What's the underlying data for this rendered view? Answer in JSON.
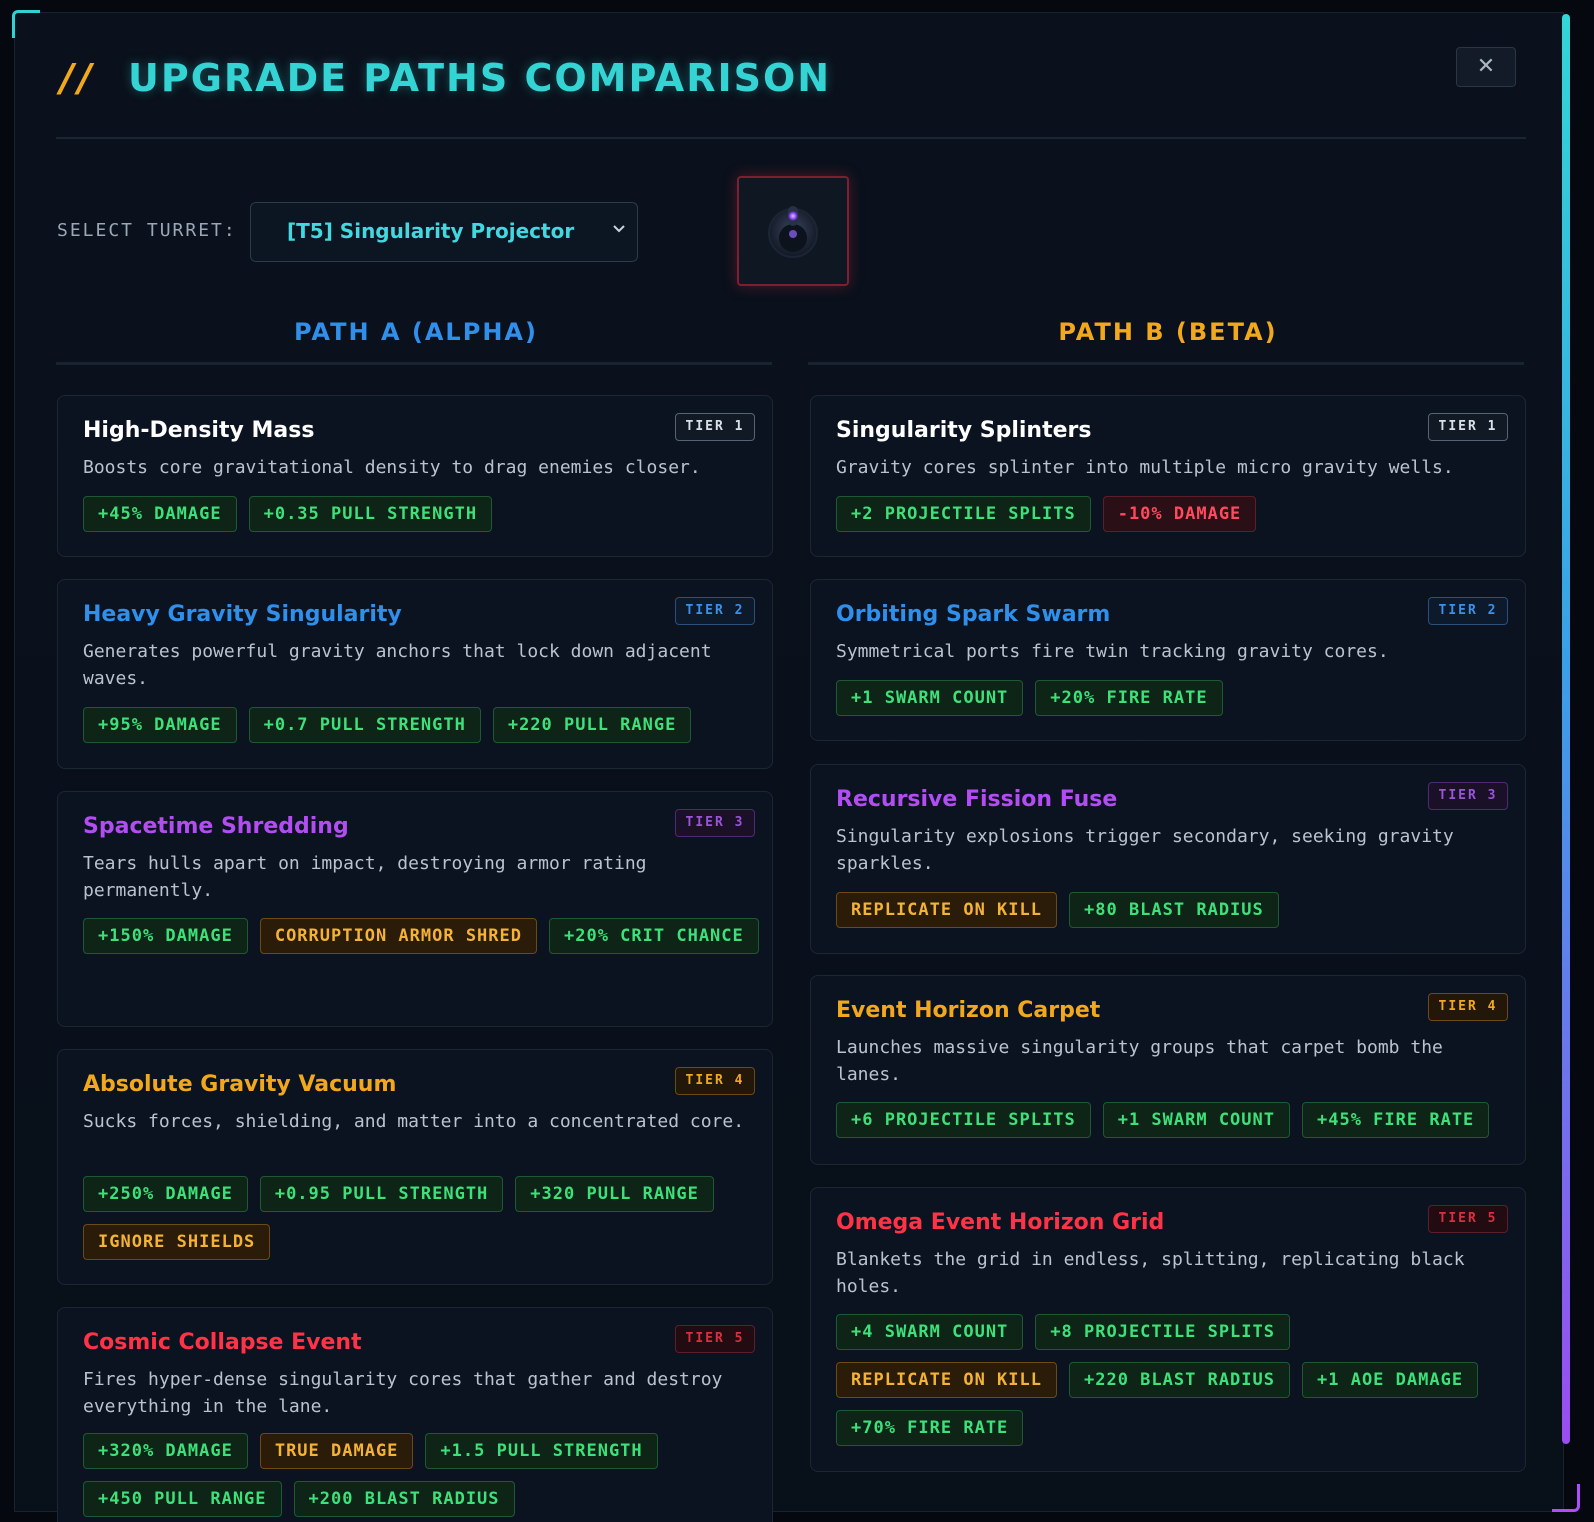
{
  "header": {
    "slash": "//",
    "title": "UPGRADE PATHS COMPARISON",
    "close_icon": "close-icon",
    "close_glyph": "✕"
  },
  "turret": {
    "label": "SELECT TURRET:",
    "selected": "[T5] Singularity Projector",
    "preview_icon": "singularity-turret-icon"
  },
  "colors": {
    "path_a": "#2f8fea",
    "path_b": "#f2a81d",
    "accent": "#35d4d4",
    "positive": "#3ee07a",
    "negative": "#ff4a5e",
    "special": "#f4b236"
  },
  "path_a": {
    "title": "PATH A (ALPHA)",
    "tiers": [
      {
        "name": "High-Density Mass",
        "tier": "TIER 1",
        "desc": "Boosts core gravitational density to drag enemies closer.",
        "tags": [
          {
            "text": "+45% DAMAGE",
            "kind": "pos"
          },
          {
            "text": "+0.35 PULL STRENGTH",
            "kind": "pos"
          }
        ]
      },
      {
        "name": "Heavy Gravity Singularity",
        "tier": "TIER 2",
        "desc": "Generates powerful gravity anchors that lock down adjacent waves.",
        "tags": [
          {
            "text": "+95% DAMAGE",
            "kind": "pos"
          },
          {
            "text": "+0.7 PULL STRENGTH",
            "kind": "pos"
          },
          {
            "text": "+220 PULL RANGE",
            "kind": "pos"
          }
        ]
      },
      {
        "name": "Spacetime Shredding",
        "tier": "TIER 3",
        "desc": "Tears hulls apart on impact, destroying armor rating permanently.",
        "tags": [
          {
            "text": "+150% DAMAGE",
            "kind": "pos"
          },
          {
            "text": "CORRUPTION ARMOR SHRED",
            "kind": "spec"
          },
          {
            "text": "+20% CRIT CHANCE",
            "kind": "pos"
          }
        ]
      },
      {
        "name": "Absolute Gravity Vacuum",
        "tier": "TIER 4",
        "desc": "Sucks forces, shielding, and matter into a concentrated core.",
        "tags": [
          {
            "text": "+250% DAMAGE",
            "kind": "pos"
          },
          {
            "text": "+0.95 PULL STRENGTH",
            "kind": "pos"
          },
          {
            "text": "+320 PULL RANGE",
            "kind": "pos"
          },
          {
            "text": "IGNORE SHIELDS",
            "kind": "spec"
          }
        ]
      },
      {
        "name": "Cosmic Collapse Event",
        "tier": "TIER 5",
        "desc": "Fires hyper-dense singularity cores that gather and destroy everything in the lane.",
        "tags": [
          {
            "text": "+320% DAMAGE",
            "kind": "pos"
          },
          {
            "text": "TRUE DAMAGE",
            "kind": "spec"
          },
          {
            "text": "+1.5 PULL STRENGTH",
            "kind": "pos"
          },
          {
            "text": "+450 PULL RANGE",
            "kind": "pos"
          },
          {
            "text": "+200 BLAST RADIUS",
            "kind": "pos"
          }
        ]
      }
    ]
  },
  "path_b": {
    "title": "PATH B (BETA)",
    "tiers": [
      {
        "name": "Singularity Splinters",
        "tier": "TIER 1",
        "desc": "Gravity cores splinter into multiple micro gravity wells.",
        "tags": [
          {
            "text": "+2 PROJECTILE SPLITS",
            "kind": "pos"
          },
          {
            "text": "-10% DAMAGE",
            "kind": "neg"
          }
        ]
      },
      {
        "name": "Orbiting Spark Swarm",
        "tier": "TIER 2",
        "desc": "Symmetrical ports fire twin tracking gravity cores.",
        "tags": [
          {
            "text": "+1 SWARM COUNT",
            "kind": "pos"
          },
          {
            "text": "+20% FIRE RATE",
            "kind": "pos"
          }
        ]
      },
      {
        "name": "Recursive Fission Fuse",
        "tier": "TIER 3",
        "desc": "Singularity explosions trigger secondary, seeking gravity sparkles.",
        "tags": [
          {
            "text": "REPLICATE ON KILL",
            "kind": "spec"
          },
          {
            "text": "+80 BLAST RADIUS",
            "kind": "pos"
          }
        ]
      },
      {
        "name": "Event Horizon Carpet",
        "tier": "TIER 4",
        "desc": "Launches massive singularity groups that carpet bomb the lanes.",
        "tags": [
          {
            "text": "+6 PROJECTILE SPLITS",
            "kind": "pos"
          },
          {
            "text": "+1 SWARM COUNT",
            "kind": "pos"
          },
          {
            "text": "+45% FIRE RATE",
            "kind": "pos"
          }
        ]
      },
      {
        "name": "Omega Event Horizon Grid",
        "tier": "TIER 5",
        "desc": "Blankets the grid in endless, splitting, replicating black holes.",
        "tags": [
          {
            "text": "+4 SWARM COUNT",
            "kind": "pos"
          },
          {
            "text": "+8 PROJECTILE SPLITS",
            "kind": "pos"
          },
          {
            "text": "REPLICATE ON KILL",
            "kind": "spec"
          },
          {
            "text": "+220 BLAST RADIUS",
            "kind": "pos"
          },
          {
            "text": "+1 AOE DAMAGE",
            "kind": "pos"
          },
          {
            "text": "+70% FIRE RATE",
            "kind": "pos"
          }
        ]
      }
    ]
  }
}
